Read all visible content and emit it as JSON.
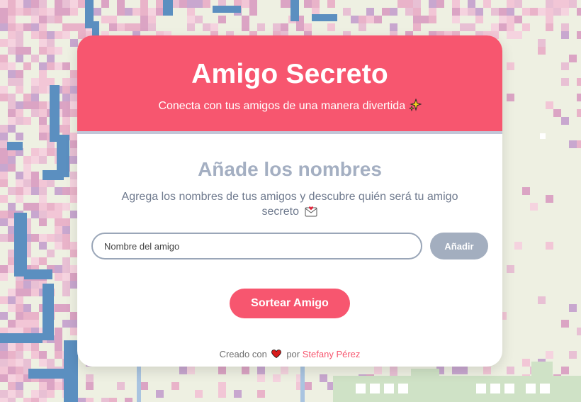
{
  "header": {
    "title": "Amigo Secreto",
    "subtitle": "Conecta con tus amigos de una manera divertida"
  },
  "main": {
    "section_title": "Añade los nombres",
    "description": "Agrega los nombres de tus amigos y descubre quién será tu amigo secreto",
    "input_placeholder": "Nombre del amigo",
    "add_button": "Añadir",
    "draw_button": "Sortear Amigo"
  },
  "footer": {
    "created_with": "Creado con",
    "by": "por",
    "author": "Stefany Pérez"
  },
  "colors": {
    "accent": "#f7566f",
    "muted_button": "#a3aebf",
    "section_title": "#a4afc2"
  },
  "icons": {
    "subtitle": "sparkles-icon",
    "description": "love-letter-icon",
    "footer": "heart-icon"
  }
}
